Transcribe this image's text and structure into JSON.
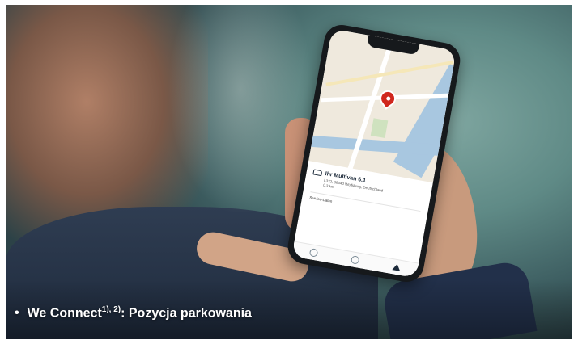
{
  "caption": {
    "bullet": "•",
    "title": "We Connect",
    "superscript": "1), 2)",
    "rest": ": Pozycja parkowania"
  },
  "phone": {
    "vehicle_name": "Ihr Multivan 6.1",
    "address": "L322, 38440 Wolfsburg, Deutschland",
    "distance": "0,3 km",
    "section_title": "Service-Daten"
  },
  "colors": {
    "background": "#5f8a86",
    "pin": "#d0271d",
    "caption_text": "#ffffff"
  }
}
